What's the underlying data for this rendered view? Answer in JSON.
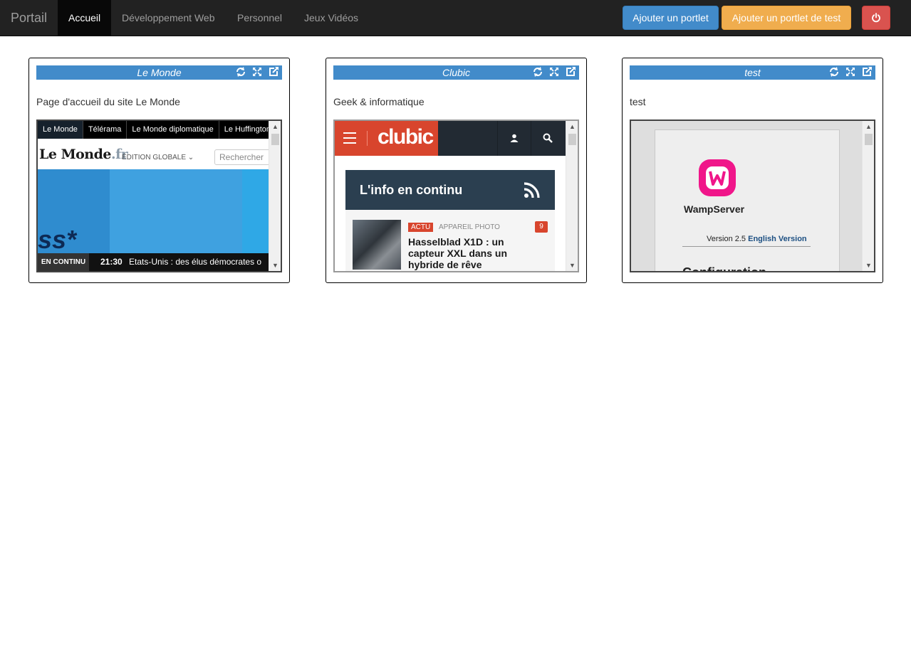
{
  "navbar": {
    "brand": "Portail",
    "tabs": [
      {
        "label": "Accueil",
        "active": true
      },
      {
        "label": "Développement Web",
        "active": false
      },
      {
        "label": "Personnel",
        "active": false
      },
      {
        "label": "Jeux Vidéos",
        "active": false
      }
    ],
    "add_portlet_label": "Ajouter un portlet",
    "add_test_portlet_label": "Ajouter un portlet de test",
    "power_icon": "power-icon"
  },
  "colors": {
    "navbar_bg": "#222222",
    "primary": "#428bca",
    "warning": "#f0ad4e",
    "danger": "#d9534f"
  },
  "portlets": [
    {
      "title": "Le Monde",
      "description": "Page d'accueil du site Le Monde",
      "tools": [
        "refresh-icon",
        "expand-icon",
        "external-link-icon"
      ],
      "frame": {
        "tabs": [
          "Le Monde",
          "Télérama",
          "Le Monde diplomatique",
          "Le Huffington"
        ],
        "logo": "Le Monde",
        "logo_suffix": ".fr",
        "edition": "ÉDITION GLOBALE ⌄",
        "search_placeholder": "Rechercher",
        "banner_text": "ss*",
        "ticker_label": "EN CONTINU",
        "ticker_time": "21:30",
        "ticker_text": "Etats-Unis : des élus démocrates o"
      }
    },
    {
      "title": "Clubic",
      "description": "Geek & informatique",
      "tools": [
        "refresh-icon",
        "expand-icon",
        "external-link-icon"
      ],
      "frame": {
        "logo": "clubic",
        "section_title": "L'info en continu",
        "badge": "ACTU",
        "category": "APPAREIL PHOTO",
        "comments": "9",
        "article_title": "Hasselblad X1D : un capteur XXL dans un hybride de rêve"
      }
    },
    {
      "title": "test",
      "description": "test",
      "tools": [
        "refresh-icon",
        "expand-icon",
        "external-link-icon"
      ],
      "frame": {
        "product": "WampServer",
        "version": "Version 2.5",
        "version_link": "English Version",
        "heading": "Configuration"
      }
    }
  ]
}
